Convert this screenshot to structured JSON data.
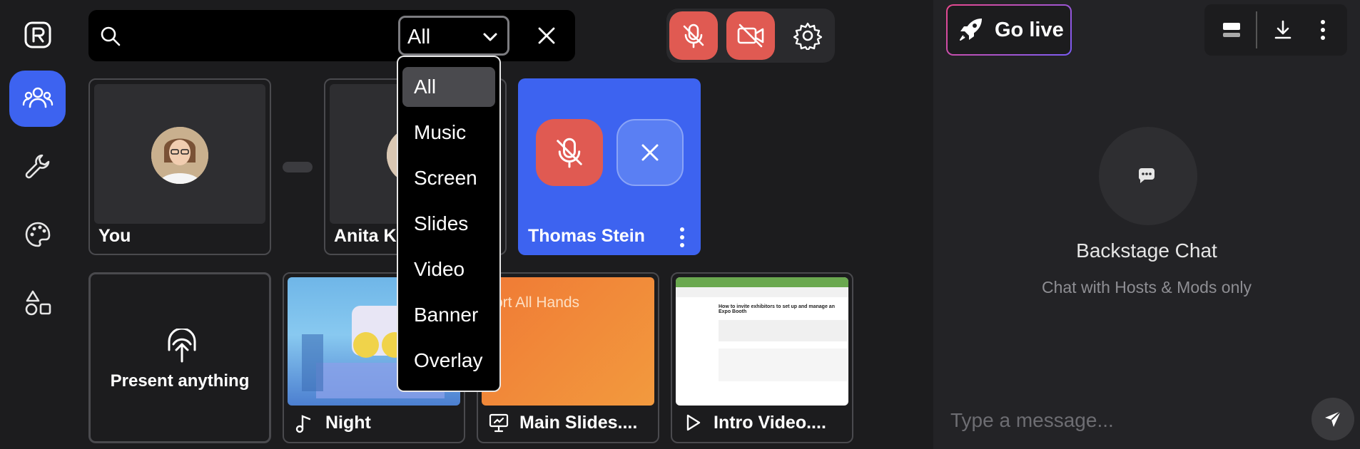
{
  "rail": {
    "items": [
      {
        "name": "people",
        "active": true
      },
      {
        "name": "wrench",
        "active": false
      },
      {
        "name": "palette",
        "active": false
      },
      {
        "name": "shapes",
        "active": false
      }
    ]
  },
  "search": {
    "placeholder": "",
    "filter_value": "All",
    "options": [
      "All",
      "Music",
      "Screen",
      "Slides",
      "Video",
      "Banner",
      "Overlay"
    ],
    "selected_index": 0
  },
  "participants": [
    {
      "name": "You"
    },
    {
      "name": "Anita Ko"
    },
    {
      "name": "Thomas Stein"
    }
  ],
  "present_label": "Present anything",
  "media": [
    {
      "label": "Night",
      "icon": "music-icon"
    },
    {
      "label": "Main Slides....",
      "icon": "slides-icon",
      "thumb_text": "ort All Hands"
    },
    {
      "label": "Intro Video....",
      "icon": "play-icon",
      "thumb_text": "How to invite exhibitors to set up and manage an Expo Booth"
    }
  ],
  "right": {
    "go_live": "Go live",
    "chat_title": "Backstage Chat",
    "chat_subtitle": "Chat with Hosts & Mods only",
    "message_placeholder": "Type a message..."
  },
  "colors": {
    "accent": "#3d63f0",
    "danger": "#e05a52",
    "background": "#1c1c1e"
  }
}
